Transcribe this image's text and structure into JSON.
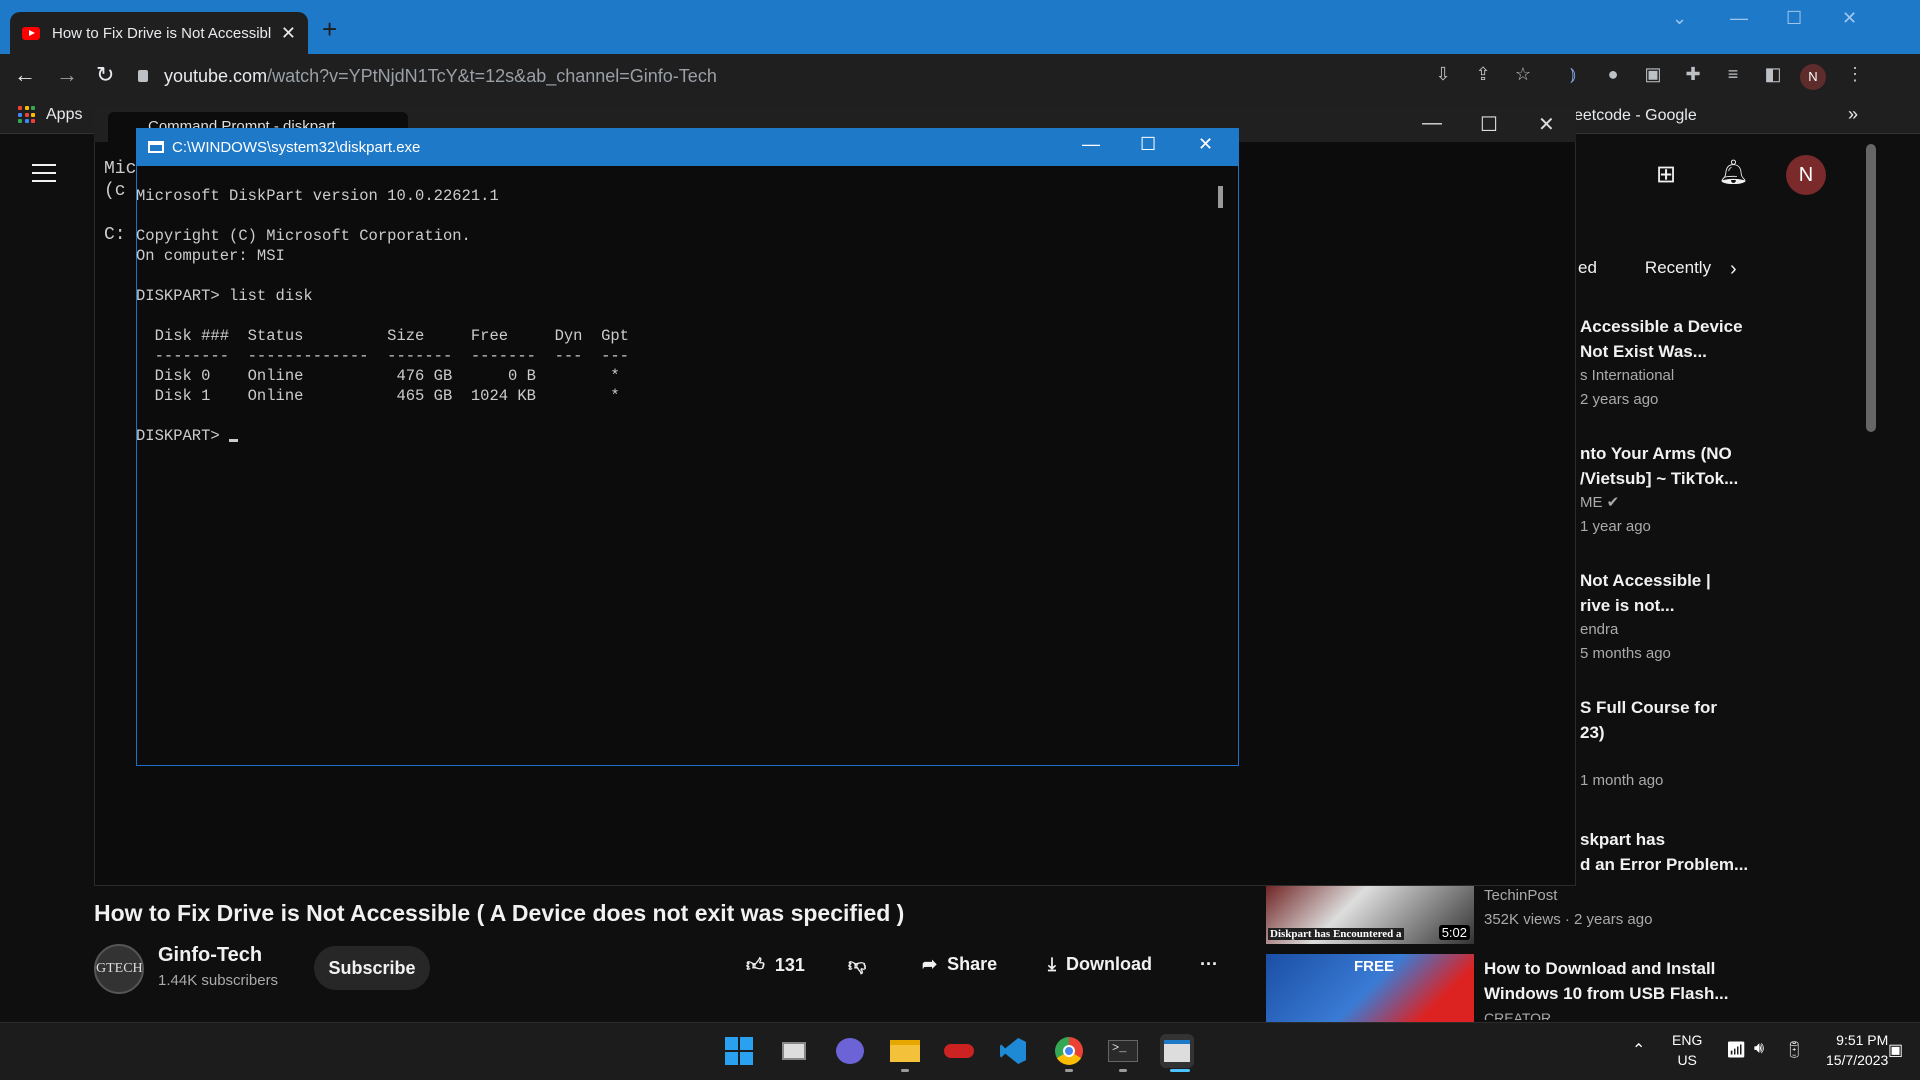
{
  "browser": {
    "tab_title": "How to Fix Drive is Not Accessibl",
    "url_main": "youtube.com",
    "url_rest": "/watch?v=YPtNjdN1TcY&t=12s&ab_channel=Ginfo-Tech",
    "profile_initial": "N",
    "bookmarks_apps": "Apps",
    "bookmark_right": "eetcode - Google",
    "bookmark_more": "»"
  },
  "cmd_back": {
    "tab_title": "Command Prompt - diskpart",
    "lines": [
      "Mic",
      "(c",
      "",
      "C:"
    ]
  },
  "diskpart": {
    "title": "C:\\WINDOWS\\system32\\diskpart.exe",
    "text": "Microsoft DiskPart version 10.0.22621.1\n\nCopyright (C) Microsoft Corporation.\nOn computer: MSI\n\nDISKPART> list disk\n\n  Disk ###  Status         Size     Free     Dyn  Gpt\n  --------  -------------  -------  -------  ---  ---\n  Disk 0    Online          476 GB      0 B        *\n  Disk 1    Online          465 GB  1024 KB        *\n\nDISKPART> "
  },
  "youtube": {
    "avatar_initial": "N",
    "chips": [
      "ed",
      "Recently"
    ],
    "recommendations": [
      {
        "title1": "Accessible a Device",
        "title2": "Not Exist Was...",
        "meta1": "s International",
        "meta2": "2 years ago"
      },
      {
        "title1": "nto Your Arms (NO",
        "title2": "/Vietsub] ~ TikTok...",
        "meta1": "ME",
        "meta2": "1 year ago"
      },
      {
        "title1": "Not Accessible |",
        "title2": "rive is not...",
        "meta1": "endra",
        "meta2": "5 months ago"
      },
      {
        "title1": "S Full Course for",
        "title2": "23)",
        "meta1": "",
        "meta2": "1 month ago"
      },
      {
        "title1": "skpart has",
        "title2": "d an Error Problem...",
        "meta1": "",
        "meta2": ""
      }
    ],
    "rec_bottom1": {
      "channel": "TechinPost",
      "meta": "352K views · 2 years ago",
      "thumb_caption": "Diskpart has Encountered a",
      "duration": "5:02"
    },
    "rec_bottom2": {
      "title1": "How to Download and Install",
      "title2": "Windows 10 from USB Flash...",
      "channel": "CREATOR",
      "thumb_label": "FREE"
    },
    "video_title": "How to Fix Drive is Not Accessible ( A Device does not exit was specified )",
    "channel_name": "Ginfo-Tech",
    "channel_avatar": "GTECH",
    "subscribers": "1.44K subscribers",
    "subscribe_label": "Subscribe",
    "likes": "131",
    "share_label": "Share",
    "download_label": "Download",
    "more_label": "···"
  },
  "taskbar": {
    "lang1": "ENG",
    "lang2": "US",
    "time": "9:51 PM",
    "date": "15/7/2023"
  }
}
